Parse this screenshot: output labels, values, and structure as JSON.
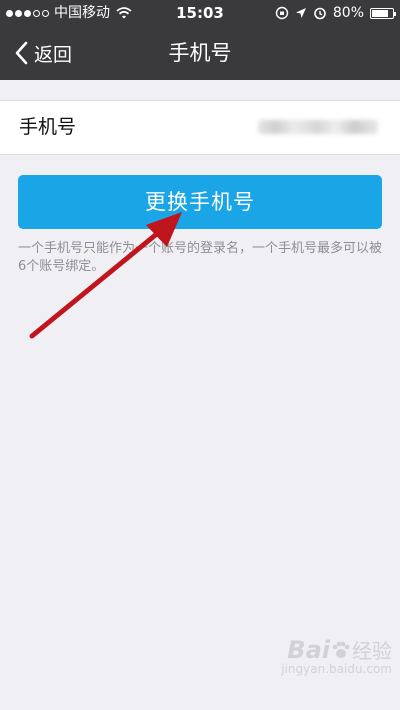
{
  "status_bar": {
    "carrier": "中国移动",
    "time": "15:03",
    "battery_percent_label": "80%",
    "battery_level": 0.8,
    "signal_bars": [
      true,
      true,
      true,
      false,
      false
    ]
  },
  "nav": {
    "back_label": "返回",
    "title": "手机号"
  },
  "phone_row": {
    "label": "手机号"
  },
  "change_button": {
    "label": "更换手机号"
  },
  "note": "一个手机号只能作为一个账号的登录名，一个手机号最多可以被6个账号绑定。",
  "watermark": {
    "brand": "Bai",
    "name": "经验",
    "domain": "jingyan.baidu.com"
  },
  "colors": {
    "nav_background": "#3a3a3c",
    "page_background": "#efeff4",
    "button": "#1aa5e6",
    "arrow": "#c0151d"
  }
}
